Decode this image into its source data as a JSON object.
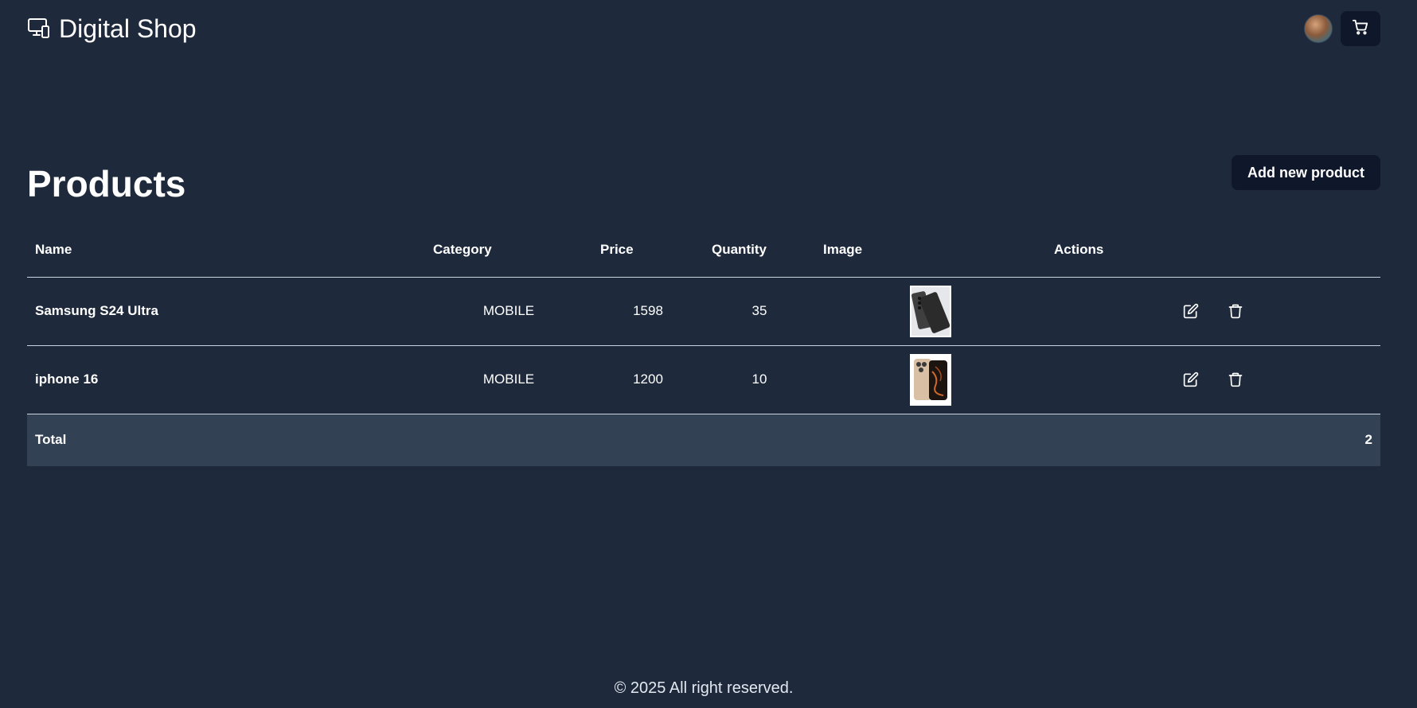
{
  "header": {
    "brand_title": "Digital Shop",
    "brand_icon": "devices-icon",
    "cart_icon": "cart-icon"
  },
  "page": {
    "title": "Products",
    "add_button_label": "Add new product"
  },
  "table": {
    "columns": [
      "Name",
      "Category",
      "Price",
      "Quantity",
      "Image",
      "Actions"
    ],
    "rows": [
      {
        "name": "Samsung S24 Ultra",
        "category": "MOBILE",
        "price": "1598",
        "quantity": "35"
      },
      {
        "name": "iphone 16",
        "category": "MOBILE",
        "price": "1200",
        "quantity": "10"
      }
    ],
    "total_label": "Total",
    "total_value": "2"
  },
  "footer": {
    "text": "© 2025 All right reserved."
  },
  "colors": {
    "background": "#1e293b",
    "button_bg": "#0f172a",
    "total_row_bg": "#334155"
  }
}
